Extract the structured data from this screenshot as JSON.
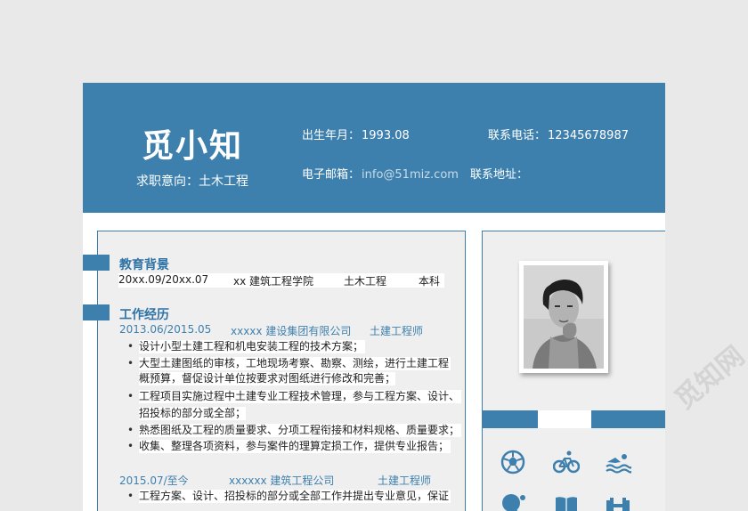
{
  "header": {
    "name": "觅小知",
    "intent_label": "求职意向：",
    "intent_value": "土木工程",
    "birth_label": "出生年月：",
    "birth_value": "1993.08",
    "phone_label": "联系电话：",
    "phone_value": "12345678987",
    "email_label": "电子邮箱：",
    "email_value": "info@51miz.com",
    "address_label": "联系地址："
  },
  "education": {
    "title": "教育背景",
    "period": "20xx.09/20xx.07",
    "school": "xx 建筑工程学院",
    "major": "土木工程",
    "degree": "本科"
  },
  "work": {
    "title": "工作经历",
    "jobs": [
      {
        "period": "2013.06/2015.05",
        "company": "xxxxx 建设集团有限公司",
        "role": "土建工程师",
        "bullets": [
          "设计小型土建工程和机电安装工程的技术方案；",
          "大型土建图纸的审核，工地现场考察、勘察、测绘，进行土建工程",
          "工程项目实施过程中土建专业工程技术管理，参与工程方案、设计、",
          "熟悉图纸及工程的质量要求、分项工程衔接和材料规格、质量要求；",
          "收集、整理各项资料，参与案件的理算定损工作，提供专业报告；"
        ],
        "continuations": [
          "概预算，督促设计单位按要求对图纸进行修改和完善；",
          "招投标的部分或全部；"
        ]
      },
      {
        "period": "2015.07/至今",
        "company": "xxxxxx 建筑工程公司",
        "role": "土建工程师",
        "bullets": [
          "工程方案、设计、招投标的部分或全部工作并提出专业意见，保证"
        ]
      }
    ]
  },
  "hobbies": [
    "soccer-icon",
    "cycling-icon",
    "swimming-icon",
    "pingpong-icon",
    "book-icon",
    "dumbbell-icon"
  ],
  "watermark": "觅知网",
  "colors": {
    "primary": "#3e80ad",
    "panel": "#efeff0",
    "page_bg": "#e9e9ea"
  }
}
